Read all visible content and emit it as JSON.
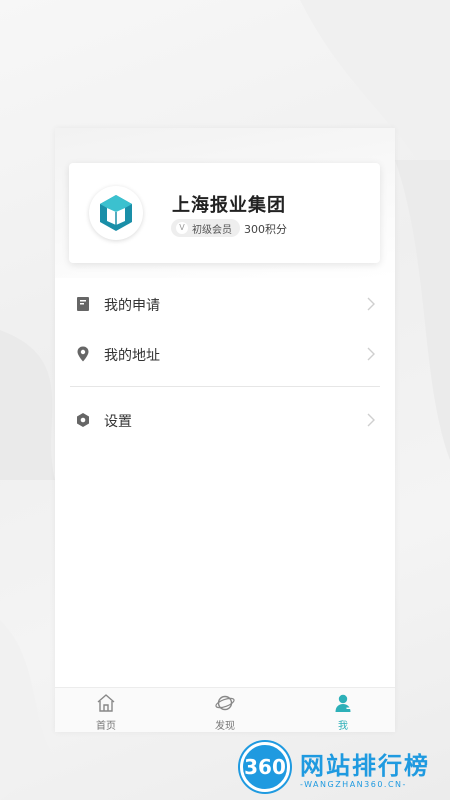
{
  "profile": {
    "org_name": "上海报业集团",
    "level_badge_letter": "V",
    "level": "初级会员",
    "points": "300积分",
    "avatar_icon": "book-cube-logo-icon"
  },
  "menu": {
    "items": [
      {
        "label": "我的申请",
        "icon": "document-icon"
      },
      {
        "label": "我的地址",
        "icon": "location-pin-icon"
      },
      {
        "label": "设置",
        "icon": "hexagon-settings-icon"
      }
    ]
  },
  "tabbar": {
    "tabs": [
      {
        "label": "首页",
        "icon": "home-icon",
        "active": false
      },
      {
        "label": "发现",
        "icon": "planet-icon",
        "active": false
      },
      {
        "label": "我",
        "icon": "user-icon",
        "active": true
      }
    ]
  },
  "watermark": {
    "logo_text": "360",
    "title": "网站排行榜",
    "subtitle": "-WANGZHAN360.CN-"
  },
  "colors": {
    "accent": "#2db0b8",
    "icon_gray": "#666666",
    "watermark_blue": "#1f9ae0"
  }
}
